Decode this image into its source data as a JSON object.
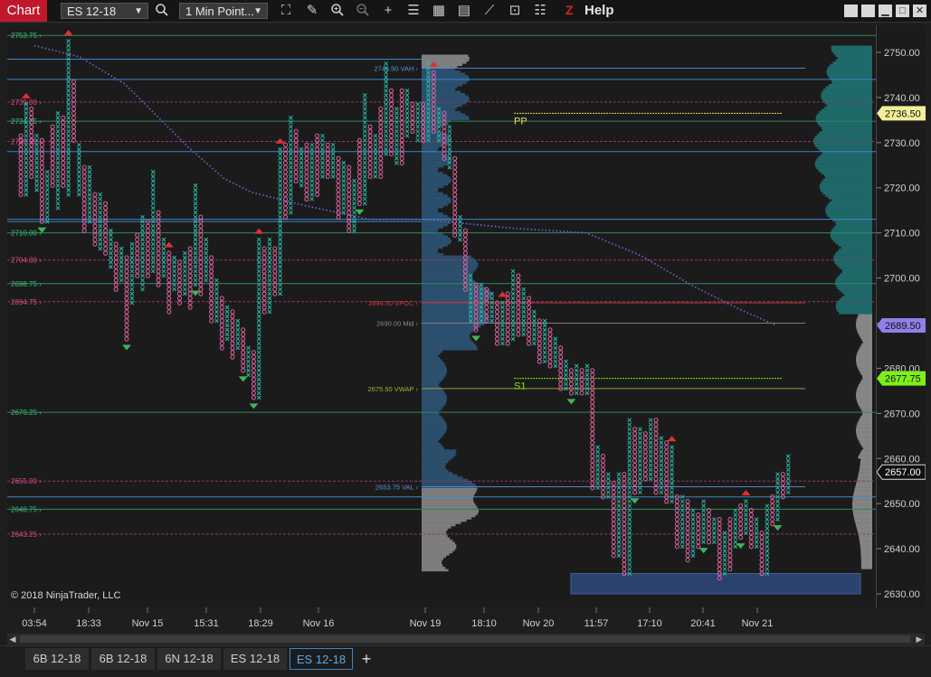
{
  "toolbar": {
    "chart_label": "Chart",
    "instrument": "ES 12-18",
    "period": "1 Min Point...",
    "help_label": "Help",
    "z_label": "Z"
  },
  "colors": {
    "up": "#2bb8a8",
    "down": "#e0639f",
    "marker_up": "#e03030",
    "marker_down": "#3fb55a",
    "accent_blue": "#3a86c8"
  },
  "chart_data": {
    "type": "point-and-figure",
    "instrument": "ES 12-18",
    "ylim": [
      2627,
      2756
    ],
    "y_ticks": [
      2630,
      2640,
      2650,
      2660,
      2670,
      2680,
      2690,
      2700,
      2710,
      2720,
      2730,
      2740,
      2750
    ],
    "x_ticks": [
      "03:54",
      "18:33",
      "Nov 15",
      "15:31",
      "18:29",
      "Nov 16",
      "Nov 19",
      "18:10",
      "Nov 20",
      "11:57",
      "17:10",
      "20:41",
      "Nov 21"
    ],
    "price_badges": [
      {
        "value": "2736.50",
        "color": "#f3ee9a"
      },
      {
        "value": "2689.50",
        "color": "#8f80e8"
      },
      {
        "value": "2677.75",
        "color": "#7df01a"
      },
      {
        "value": "2657.00",
        "color": "#111111"
      }
    ],
    "level_labels": [
      {
        "text": "2753.75",
        "price": 2753.75,
        "color": "#3fbf7f"
      },
      {
        "text": "2739.00",
        "price": 2739.0,
        "color": "#e04a8a"
      },
      {
        "text": "2734.75",
        "price": 2734.75,
        "color": "#3fbf7f"
      },
      {
        "text": "2730.25",
        "price": 2730.25,
        "color": "#e04a8a"
      },
      {
        "text": "2710.00",
        "price": 2710.0,
        "color": "#3fbf7f"
      },
      {
        "text": "2704.00",
        "price": 2704.0,
        "color": "#e04a8a"
      },
      {
        "text": "2698.75",
        "price": 2698.75,
        "color": "#3fbf7f"
      },
      {
        "text": "2694.75",
        "price": 2694.75,
        "color": "#e04a8a"
      },
      {
        "text": "2670.25",
        "price": 2670.25,
        "color": "#3fbf7f"
      },
      {
        "text": "2655.00",
        "price": 2655.0,
        "color": "#e04a8a"
      },
      {
        "text": "2648.75",
        "price": 2648.75,
        "color": "#3fbf7f"
      },
      {
        "text": "2643.25",
        "price": 2643.25,
        "color": "#e04a8a"
      }
    ],
    "profile_labels": [
      {
        "text": "2746.50 VAH",
        "price": 2746.5,
        "color": "#5b8fd6"
      },
      {
        "text": "2694.50 VPOC",
        "price": 2694.5,
        "color": "#d23a3a"
      },
      {
        "text": "2690.00 Mid",
        "price": 2690.0,
        "color": "#888888"
      },
      {
        "text": "2675.50 VWAP",
        "price": 2675.5,
        "color": "#a8a83a"
      },
      {
        "text": "2653.75 VAL",
        "price": 2653.75,
        "color": "#5b8fd6"
      }
    ],
    "pivot_labels": [
      {
        "text": "PP",
        "price": 2736.5,
        "color": "#e6e25a"
      },
      {
        "text": "S1",
        "price": 2677.75,
        "color": "#7df01a"
      }
    ],
    "pnf_columns": [
      {
        "type": "o",
        "lo": 2718,
        "hi": 2731
      },
      {
        "type": "x",
        "lo": 2718,
        "hi": 2738
      },
      {
        "type": "o",
        "lo": 2722,
        "hi": 2737
      },
      {
        "type": "x",
        "lo": 2719,
        "hi": 2731
      },
      {
        "type": "o",
        "lo": 2712,
        "hi": 2730
      },
      {
        "type": "x",
        "lo": 2712,
        "hi": 2723
      },
      {
        "type": "o",
        "lo": 2720,
        "hi": 2733
      },
      {
        "type": "x",
        "lo": 2715,
        "hi": 2736
      },
      {
        "type": "o",
        "lo": 2720,
        "hi": 2735
      },
      {
        "type": "x",
        "lo": 2718,
        "hi": 2752
      },
      {
        "type": "o",
        "lo": 2730,
        "hi": 2743
      },
      {
        "type": "x",
        "lo": 2718,
        "hi": 2729
      },
      {
        "type": "o",
        "lo": 2710,
        "hi": 2724
      },
      {
        "type": "x",
        "lo": 2712,
        "hi": 2724
      },
      {
        "type": "o",
        "lo": 2707,
        "hi": 2718
      },
      {
        "type": "x",
        "lo": 2706,
        "hi": 2718
      },
      {
        "type": "o",
        "lo": 2705,
        "hi": 2716
      },
      {
        "type": "x",
        "lo": 2702,
        "hi": 2710
      },
      {
        "type": "o",
        "lo": 2697,
        "hi": 2707
      },
      {
        "type": "x",
        "lo": 2699,
        "hi": 2706
      },
      {
        "type": "o",
        "lo": 2686,
        "hi": 2704
      },
      {
        "type": "x",
        "lo": 2694,
        "hi": 2707
      },
      {
        "type": "o",
        "lo": 2700,
        "hi": 2709
      },
      {
        "type": "x",
        "lo": 2697,
        "hi": 2713
      },
      {
        "type": "o",
        "lo": 2700,
        "hi": 2712
      },
      {
        "type": "x",
        "lo": 2701,
        "hi": 2723
      },
      {
        "type": "o",
        "lo": 2698,
        "hi": 2714
      },
      {
        "type": "x",
        "lo": 2700,
        "hi": 2708
      },
      {
        "type": "o",
        "lo": 2692,
        "hi": 2705
      },
      {
        "type": "x",
        "lo": 2697,
        "hi": 2704
      },
      {
        "type": "o",
        "lo": 2694,
        "hi": 2703
      },
      {
        "type": "x",
        "lo": 2696,
        "hi": 2705
      },
      {
        "type": "o",
        "lo": 2693,
        "hi": 2706
      },
      {
        "type": "x",
        "lo": 2698,
        "hi": 2720
      },
      {
        "type": "o",
        "lo": 2696,
        "hi": 2713
      },
      {
        "type": "x",
        "lo": 2699,
        "hi": 2708
      },
      {
        "type": "o",
        "lo": 2690,
        "hi": 2704
      },
      {
        "type": "x",
        "lo": 2690,
        "hi": 2699
      },
      {
        "type": "o",
        "lo": 2684,
        "hi": 2695
      },
      {
        "type": "x",
        "lo": 2686,
        "hi": 2693
      },
      {
        "type": "o",
        "lo": 2682,
        "hi": 2692
      },
      {
        "type": "x",
        "lo": 2684,
        "hi": 2690
      },
      {
        "type": "o",
        "lo": 2679,
        "hi": 2688
      },
      {
        "type": "x",
        "lo": 2678,
        "hi": 2684
      },
      {
        "type": "o",
        "lo": 2673,
        "hi": 2683
      },
      {
        "type": "x",
        "lo": 2673,
        "hi": 2708
      },
      {
        "type": "o",
        "lo": 2692,
        "hi": 2706
      },
      {
        "type": "x",
        "lo": 2692,
        "hi": 2708
      },
      {
        "type": "o",
        "lo": 2696,
        "hi": 2706
      },
      {
        "type": "x",
        "lo": 2696,
        "hi": 2728
      },
      {
        "type": "o",
        "lo": 2713,
        "hi": 2729
      },
      {
        "type": "x",
        "lo": 2714,
        "hi": 2735
      },
      {
        "type": "o",
        "lo": 2721,
        "hi": 2732
      },
      {
        "type": "x",
        "lo": 2720,
        "hi": 2728
      },
      {
        "type": "o",
        "lo": 2717,
        "hi": 2729
      },
      {
        "type": "x",
        "lo": 2717,
        "hi": 2729
      },
      {
        "type": "o",
        "lo": 2718,
        "hi": 2731
      },
      {
        "type": "x",
        "lo": 2722,
        "hi": 2731
      },
      {
        "type": "o",
        "lo": 2722,
        "hi": 2729
      },
      {
        "type": "x",
        "lo": 2722,
        "hi": 2729
      },
      {
        "type": "o",
        "lo": 2713,
        "hi": 2726
      },
      {
        "type": "x",
        "lo": 2714,
        "hi": 2725
      },
      {
        "type": "o",
        "lo": 2710,
        "hi": 2724
      },
      {
        "type": "x",
        "lo": 2710,
        "hi": 2721
      },
      {
        "type": "o",
        "lo": 2716,
        "hi": 2730
      },
      {
        "type": "x",
        "lo": 2716,
        "hi": 2740
      },
      {
        "type": "o",
        "lo": 2722,
        "hi": 2733
      },
      {
        "type": "x",
        "lo": 2722,
        "hi": 2731
      },
      {
        "type": "o",
        "lo": 2722,
        "hi": 2737
      },
      {
        "type": "x",
        "lo": 2727,
        "hi": 2747
      },
      {
        "type": "o",
        "lo": 2727,
        "hi": 2741
      },
      {
        "type": "x",
        "lo": 2725,
        "hi": 2737
      },
      {
        "type": "o",
        "lo": 2725,
        "hi": 2741
      },
      {
        "type": "x",
        "lo": 2731,
        "hi": 2741
      },
      {
        "type": "o",
        "lo": 2732,
        "hi": 2738
      },
      {
        "type": "x",
        "lo": 2730,
        "hi": 2738
      },
      {
        "type": "o",
        "lo": 2730,
        "hi": 2738
      },
      {
        "type": "x",
        "lo": 2730,
        "hi": 2747
      },
      {
        "type": "o",
        "lo": 2732,
        "hi": 2745
      },
      {
        "type": "x",
        "lo": 2730,
        "hi": 2737
      },
      {
        "type": "o",
        "lo": 2726,
        "hi": 2736
      },
      {
        "type": "x",
        "lo": 2724,
        "hi": 2733
      },
      {
        "type": "o",
        "lo": 2709,
        "hi": 2726
      },
      {
        "type": "x",
        "lo": 2708,
        "hi": 2713
      },
      {
        "type": "o",
        "lo": 2697,
        "hi": 2710
      },
      {
        "type": "x",
        "lo": 2690,
        "hi": 2700
      },
      {
        "type": "o",
        "lo": 2688,
        "hi": 2698
      },
      {
        "type": "x",
        "lo": 2690,
        "hi": 2698
      },
      {
        "type": "o",
        "lo": 2690,
        "hi": 2697
      },
      {
        "type": "x",
        "lo": 2690,
        "hi": 2696
      },
      {
        "type": "o",
        "lo": 2685,
        "hi": 2694
      },
      {
        "type": "x",
        "lo": 2685,
        "hi": 2694
      },
      {
        "type": "o",
        "lo": 2685,
        "hi": 2696
      },
      {
        "type": "x",
        "lo": 2686,
        "hi": 2701
      },
      {
        "type": "o",
        "lo": 2687,
        "hi": 2700
      },
      {
        "type": "x",
        "lo": 2687,
        "hi": 2697
      },
      {
        "type": "o",
        "lo": 2685,
        "hi": 2695
      },
      {
        "type": "x",
        "lo": 2685,
        "hi": 2692
      },
      {
        "type": "o",
        "lo": 2681,
        "hi": 2690
      },
      {
        "type": "x",
        "lo": 2681,
        "hi": 2690
      },
      {
        "type": "o",
        "lo": 2680,
        "hi": 2688
      },
      {
        "type": "x",
        "lo": 2680,
        "hi": 2686
      },
      {
        "type": "o",
        "lo": 2675,
        "hi": 2684
      },
      {
        "type": "x",
        "lo": 2675,
        "hi": 2681
      },
      {
        "type": "o",
        "lo": 2674,
        "hi": 2679
      },
      {
        "type": "x",
        "lo": 2674,
        "hi": 2680
      },
      {
        "type": "o",
        "lo": 2674,
        "hi": 2679
      },
      {
        "type": "x",
        "lo": 2674,
        "hi": 2680
      },
      {
        "type": "o",
        "lo": 2653,
        "hi": 2679
      },
      {
        "type": "x",
        "lo": 2653,
        "hi": 2662
      },
      {
        "type": "o",
        "lo": 2651,
        "hi": 2660
      },
      {
        "type": "x",
        "lo": 2651,
        "hi": 2656
      },
      {
        "type": "o",
        "lo": 2638,
        "hi": 2654
      },
      {
        "type": "x",
        "lo": 2638,
        "hi": 2656
      },
      {
        "type": "o",
        "lo": 2634,
        "hi": 2656
      },
      {
        "type": "x",
        "lo": 2634,
        "hi": 2668
      },
      {
        "type": "o",
        "lo": 2652,
        "hi": 2666
      },
      {
        "type": "x",
        "lo": 2652,
        "hi": 2666
      },
      {
        "type": "o",
        "lo": 2655,
        "hi": 2665
      },
      {
        "type": "x",
        "lo": 2655,
        "hi": 2668
      },
      {
        "type": "o",
        "lo": 2652,
        "hi": 2668
      },
      {
        "type": "x",
        "lo": 2652,
        "hi": 2664
      },
      {
        "type": "o",
        "lo": 2650,
        "hi": 2663
      },
      {
        "type": "x",
        "lo": 2650,
        "hi": 2662
      },
      {
        "type": "o",
        "lo": 2640,
        "hi": 2651
      },
      {
        "type": "x",
        "lo": 2640,
        "hi": 2651
      },
      {
        "type": "o",
        "lo": 2637,
        "hi": 2650
      },
      {
        "type": "x",
        "lo": 2638,
        "hi": 2648
      },
      {
        "type": "o",
        "lo": 2640,
        "hi": 2647
      },
      {
        "type": "x",
        "lo": 2641,
        "hi": 2650
      },
      {
        "type": "o",
        "lo": 2641,
        "hi": 2648
      },
      {
        "type": "x",
        "lo": 2641,
        "hi": 2646
      },
      {
        "type": "o",
        "lo": 2633,
        "hi": 2646
      },
      {
        "type": "x",
        "lo": 2634,
        "hi": 2643
      },
      {
        "type": "o",
        "lo": 2635,
        "hi": 2646
      },
      {
        "type": "x",
        "lo": 2640,
        "hi": 2648
      },
      {
        "type": "o",
        "lo": 2642,
        "hi": 2649
      },
      {
        "type": "x",
        "lo": 2643,
        "hi": 2650
      },
      {
        "type": "o",
        "lo": 2640,
        "hi": 2648
      },
      {
        "type": "x",
        "lo": 2640,
        "hi": 2646
      },
      {
        "type": "o",
        "lo": 2634,
        "hi": 2643
      },
      {
        "type": "x",
        "lo": 2634,
        "hi": 2649
      },
      {
        "type": "o",
        "lo": 2645,
        "hi": 2651
      },
      {
        "type": "x",
        "lo": 2646,
        "hi": 2656
      },
      {
        "type": "o",
        "lo": 2651,
        "hi": 2656
      },
      {
        "type": "x",
        "lo": 2652,
        "hi": 2660
      }
    ],
    "reversal_markers": [
      {
        "col": 1,
        "dir": "up"
      },
      {
        "col": 9,
        "dir": "up"
      },
      {
        "col": 4,
        "dir": "down"
      },
      {
        "col": 20,
        "dir": "down"
      },
      {
        "col": 28,
        "dir": "up"
      },
      {
        "col": 33,
        "dir": "down"
      },
      {
        "col": 42,
        "dir": "down"
      },
      {
        "col": 44,
        "dir": "down"
      },
      {
        "col": 45,
        "dir": "up"
      },
      {
        "col": 49,
        "dir": "up"
      },
      {
        "col": 64,
        "dir": "down"
      },
      {
        "col": 78,
        "dir": "up"
      },
      {
        "col": 86,
        "dir": "down"
      },
      {
        "col": 91,
        "dir": "up"
      },
      {
        "col": 104,
        "dir": "down"
      },
      {
        "col": 116,
        "dir": "down"
      },
      {
        "col": 123,
        "dir": "up"
      },
      {
        "col": 129,
        "dir": "down"
      },
      {
        "col": 136,
        "dir": "down"
      },
      {
        "col": 137,
        "dir": "up"
      },
      {
        "col": 143,
        "dir": "down"
      }
    ]
  },
  "copyright": "© 2018 NinjaTrader, LLC",
  "tabs": [
    {
      "label": "6B 12-18",
      "active": false
    },
    {
      "label": "6B 12-18",
      "active": false
    },
    {
      "label": "6N 12-18",
      "active": false
    },
    {
      "label": "ES 12-18",
      "active": false
    },
    {
      "label": "ES 12-18",
      "active": true
    }
  ],
  "add_tab_label": "+"
}
